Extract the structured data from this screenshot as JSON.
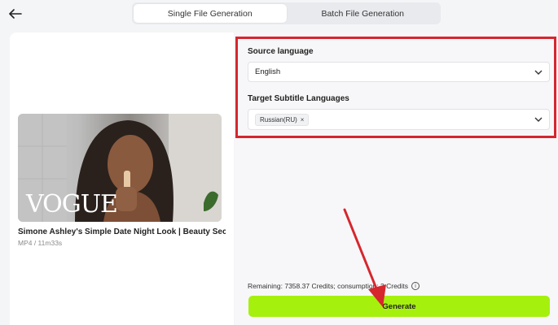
{
  "header": {
    "back_icon": "arrow-left-icon",
    "tabs": [
      {
        "label": "Single File Generation",
        "active": true
      },
      {
        "label": "Batch File Generation",
        "active": false
      }
    ]
  },
  "video": {
    "watermark": "VOGUE",
    "title": "Simone Ashley's Simple Date Night Look | Beauty Secrets...",
    "meta": "MP4 / 11m33s"
  },
  "form": {
    "source_language": {
      "label": "Source language",
      "value": "English"
    },
    "target_languages": {
      "label": "Target Subtitle Languages",
      "tags": [
        "Russian(RU)"
      ]
    }
  },
  "footer": {
    "remaining_text": "Remaining: 7358.37 Credits; consumption: 3 Credits",
    "generate_label": "Generate"
  },
  "colors": {
    "accent_green": "#a6f00e",
    "highlight_red": "#d6262e"
  }
}
